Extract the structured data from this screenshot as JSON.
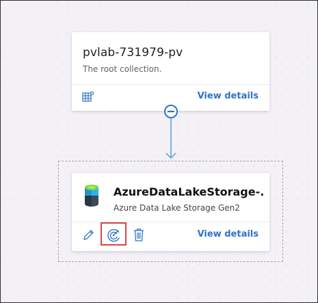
{
  "collection": {
    "name": "pvlab-731979-pv",
    "description": "The root collection.",
    "view_details": "View details",
    "icons": [
      "table-gear-icon"
    ]
  },
  "connector": {
    "toggle_icon": "collapse-minus-icon"
  },
  "data_source": {
    "name": "AzureDataLakeStorage-...",
    "type": "Azure Data Lake Storage Gen2",
    "view_details": "View details",
    "icons": [
      "azure-data-lake-storage-icon",
      "edit-pencil-icon",
      "new-scan-icon",
      "delete-trash-icon"
    ]
  },
  "colors": {
    "accent": "#2f73c3",
    "highlight": "#d64545",
    "background": "#f3f1f6"
  }
}
